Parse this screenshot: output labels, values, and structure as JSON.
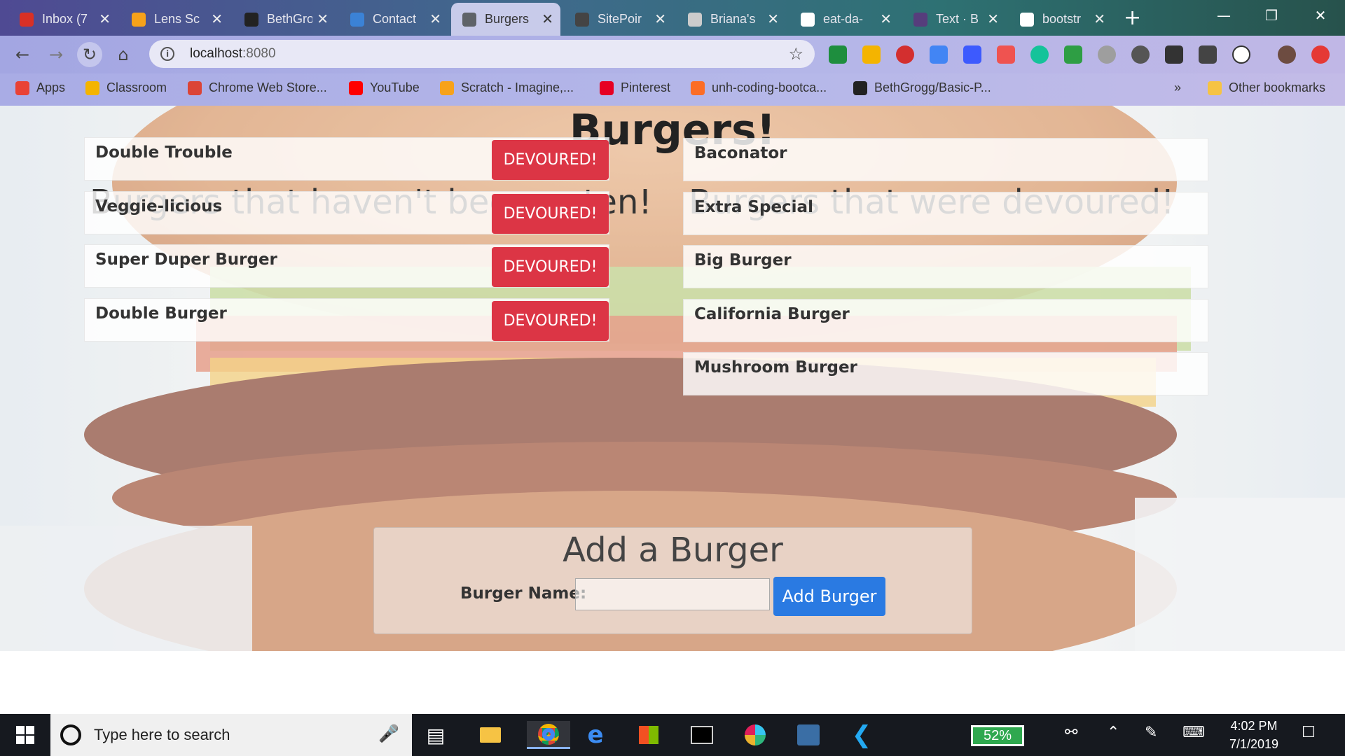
{
  "browser": {
    "tabs": [
      {
        "title": "Inbox (7",
        "icon": "gmail-icon",
        "color": "#d93025"
      },
      {
        "title": "Lens Sc",
        "icon": "lens-icon",
        "color": "#f6a21a"
      },
      {
        "title": "BethGro",
        "icon": "github-icon",
        "color": "#222222"
      },
      {
        "title": "Contact",
        "icon": "wordpress-icon",
        "color": "#3b82d6"
      },
      {
        "title": "Burgers",
        "icon": "globe-icon",
        "color": "#5f6368",
        "active": true
      },
      {
        "title": "SitePoir",
        "icon": "sitepoint-icon",
        "color": "#444444"
      },
      {
        "title": "Briana's",
        "icon": "pin-icon",
        "color": "#cccccc"
      },
      {
        "title": "eat-da-",
        "icon": "google-icon",
        "color": "#ffffff"
      },
      {
        "title": "Text · B",
        "icon": "bootstrap-icon",
        "color": "#563d7c"
      },
      {
        "title": "bootstr",
        "icon": "google-icon",
        "color": "#ffffff"
      }
    ],
    "url_host": "localhost",
    "url_port": ":8080",
    "bookmarks": [
      {
        "label": "Apps",
        "icon": "apps-grid-icon",
        "color": "#e94235"
      },
      {
        "label": "Classroom",
        "icon": "classroom-icon",
        "color": "#f4b400"
      },
      {
        "label": "Chrome Web Store...",
        "icon": "webstore-icon",
        "color": "#db4437"
      },
      {
        "label": "YouTube",
        "icon": "youtube-icon",
        "color": "#ff0000"
      },
      {
        "label": "Scratch - Imagine,...",
        "icon": "scratch-icon",
        "color": "#f7a21a"
      },
      {
        "label": "Pinterest",
        "icon": "pinterest-icon",
        "color": "#e60023"
      },
      {
        "label": "unh-coding-bootca...",
        "icon": "gitlab-icon",
        "color": "#fc6d26"
      },
      {
        "label": "BethGrogg/Basic-P...",
        "icon": "github-icon",
        "color": "#222222"
      }
    ],
    "other_bookmarks": "Other bookmarks",
    "overflow": "»"
  },
  "page": {
    "title": "Burgers!",
    "uneaten_heading": "Burgers that haven't been eaten!",
    "devoured_heading": "Burgers that were devoured!",
    "uneaten": [
      {
        "name": "Double Trouble",
        "button": "DEVOURED!"
      },
      {
        "name": "Veggie-licious",
        "button": "DEVOURED!"
      },
      {
        "name": "Super Duper Burger",
        "button": "DEVOURED!"
      },
      {
        "name": "Double Burger",
        "button": "DEVOURED!"
      }
    ],
    "devoured": [
      {
        "name": "Baconator"
      },
      {
        "name": "Extra Special"
      },
      {
        "name": "Big Burger"
      },
      {
        "name": "California Burger"
      },
      {
        "name": "Mushroom Burger"
      }
    ],
    "add_form": {
      "heading": "Add a Burger",
      "label": "Burger Name:",
      "input_value": "",
      "button": "Add Burger"
    },
    "colors": {
      "devour_button": "#dc3545",
      "add_button": "#2a7ae2"
    }
  },
  "taskbar": {
    "search_placeholder": "Type here to search",
    "battery": "52%",
    "time": "4:02 PM",
    "date": "7/1/2019"
  }
}
